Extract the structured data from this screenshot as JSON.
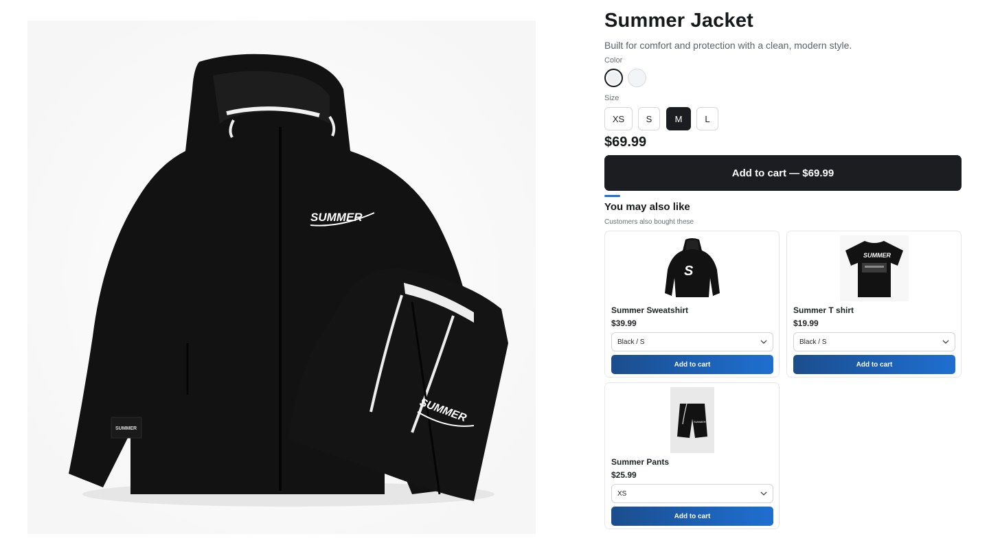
{
  "product": {
    "title": "Summer Jacket",
    "subtitle": "Built for comfort and protection with a clean, modern style.",
    "image_icon": "jacket-photo",
    "color_label": "Color",
    "colors": [
      {
        "name": "black",
        "swatch": "#16181b",
        "selected": true
      },
      {
        "name": "white",
        "swatch": "#f2f4f6",
        "selected": false
      }
    ],
    "size_label": "Size",
    "sizes": [
      "XS",
      "S",
      "M",
      "L"
    ],
    "selected_size": "M",
    "price": "$69.99",
    "add_to_cart_label": "Add to cart — $69.99",
    "logo_text": "SUMMER"
  },
  "recommendations": {
    "title": "You may also like",
    "subtitle": "Customers also bought these",
    "items": [
      {
        "name": "Summer Sweatshirt",
        "price": "$39.99",
        "variant": "Black / S",
        "button": "Add to cart"
      },
      {
        "name": "Summer T shirt",
        "price": "$19.99",
        "variant": "Black / S",
        "button": "Add to cart"
      },
      {
        "name": "Summer Pants",
        "price": "$25.99",
        "variant": "XS",
        "button": "Add to cart"
      }
    ]
  },
  "colors": {
    "primary_dark": "#1b1d20",
    "accent_blue": "#1d6fd6",
    "button_blue": "#1d62b8"
  }
}
